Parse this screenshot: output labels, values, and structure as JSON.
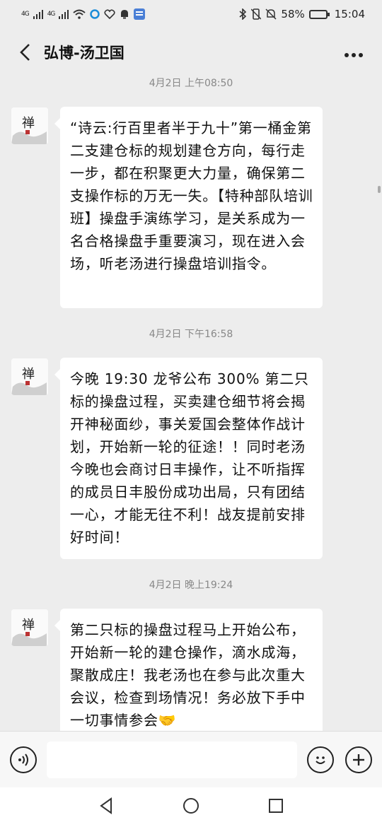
{
  "status_bar": {
    "network1": "4G",
    "network2": "4G",
    "battery_percent": "58%",
    "battery_level": 0.58,
    "time": "15:04"
  },
  "header": {
    "title": "弘博-汤卫国",
    "more_icon": "more-dots-icon",
    "back_icon": "chevron-left-icon"
  },
  "messages": [
    {
      "timestamp": "4月2日 上午08:50",
      "text": "“诗云:行百里者半于九十”第一桶金第二支建仓标的规划建仓方向，每行走一步，都在积聚更大力量，确保第二支操作标的万无一失。【特种部队培训班】操盘手演练学习，是关系成为一名合格操盘手重要演习，现在进入会场，听老汤进行操盘培训指令。"
    },
    {
      "timestamp": "4月2日 下午16:58",
      "text": "今晚 19:30 龙爷公布 300% 第二只标的操盘过程，买卖建仓细节将会揭开神秘面纱，事关爱国会整体作战计划，开始新一轮的征途！！同时老汤今晚也会商讨日丰操作，让不听指挥的成员日丰股份成功出局，只有团结一心，才能无往不利！战友提前安排好时间！"
    },
    {
      "timestamp": "4月2日 晚上19:24",
      "text": "第二只标的操盘过程马上开始公布，开始新一轮的建仓操作，滴水成海，聚散成庄！我老汤也在参与此次重大会议，检查到场情况！务必放下手中一切事情参会🤝"
    }
  ],
  "input_bar": {
    "voice_icon": "voice-icon",
    "emoji_icon": "emoji-icon",
    "plus_icon": "plus-icon",
    "input_value": ""
  },
  "nav_bar": {
    "back_icon": "nav-back-icon",
    "home_icon": "nav-home-icon",
    "recents_icon": "nav-recents-icon"
  },
  "colors": {
    "background": "#ededed",
    "bubble": "#ffffff",
    "timestamp": "#888888"
  }
}
